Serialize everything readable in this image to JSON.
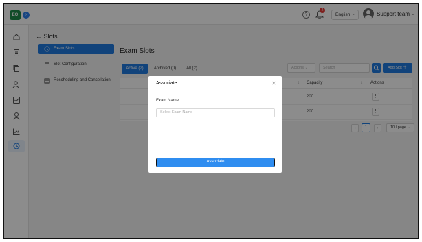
{
  "header": {
    "logo_text": "EO",
    "notification_count": "2",
    "language": "English",
    "user_name": "Support team"
  },
  "sidebar": {
    "icons": [
      "home-icon",
      "document-icon",
      "copy-icon",
      "user-search-icon",
      "checklist-icon",
      "person-icon",
      "chart-icon",
      "slot-settings-icon"
    ]
  },
  "subnav": {
    "back_title": "Slots",
    "items": [
      {
        "label": "Exam Slots",
        "icon": "clock-icon"
      },
      {
        "label": "Slot Configuration",
        "icon": "config-icon"
      },
      {
        "label": "Rescheduling and Cancellation",
        "icon": "calendar-icon"
      }
    ]
  },
  "main": {
    "title": "Exam Slots",
    "tabs": [
      "Active (2)",
      "Archived (0)",
      "All (2)"
    ],
    "actions_label": "Actions",
    "search_placeholder": "Search",
    "add_button": "Add Slot",
    "columns": [
      "Capacity",
      "Actions"
    ],
    "rows": [
      {
        "capacity": "200"
      },
      {
        "capacity": "200"
      }
    ],
    "pager": {
      "current": "1",
      "per_page": "10 / page"
    }
  },
  "modal": {
    "title": "Associate",
    "field_label": "Exam Name",
    "field_placeholder": "Select Exam Name",
    "submit_label": "Associate"
  },
  "colors": {
    "primary": "#1f7ae0",
    "brand": "#1f8a4c",
    "overlay": "rgba(0,0,0,0.45)"
  }
}
